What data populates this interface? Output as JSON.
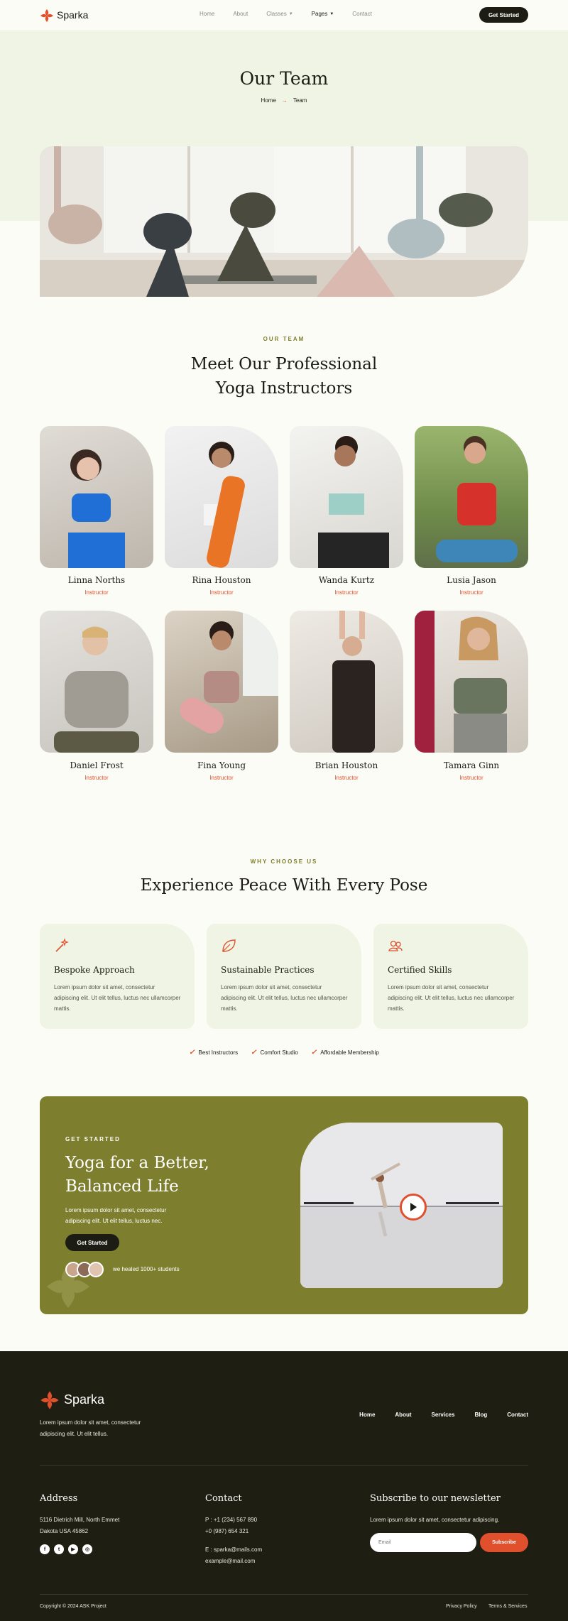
{
  "nav": {
    "brand": "Sparka",
    "links": [
      "Home",
      "About",
      "Classes",
      "Pages",
      "Contact"
    ],
    "cta": "Get Started"
  },
  "hero": {
    "title": "Our Team",
    "crumb_home": "Home",
    "crumb_current": "Team"
  },
  "team": {
    "eyebrow": "OUR TEAM",
    "title": "Meet Our Professional Yoga Instructors",
    "members": [
      {
        "name": "Linna Norths",
        "role": "Instructor"
      },
      {
        "name": "Rina Houston",
        "role": "Instructor"
      },
      {
        "name": "Wanda Kurtz",
        "role": "Instructor"
      },
      {
        "name": "Lusia Jason",
        "role": "Instructor"
      },
      {
        "name": "Daniel Frost",
        "role": "Instructor"
      },
      {
        "name": "Fina Young",
        "role": "Instructor"
      },
      {
        "name": "Brian Houston",
        "role": "Instructor"
      },
      {
        "name": "Tamara Ginn",
        "role": "Instructor"
      }
    ]
  },
  "why": {
    "eyebrow": "WHY CHOOSE US",
    "title": "Experience Peace With Every Pose",
    "cards": [
      {
        "title": "Bespoke Approach",
        "text": "Lorem ipsum dolor sit amet, consectetur adipiscing elit. Ut elit tellus, luctus nec ullamcorper mattis.",
        "icon": "magic-wand-icon"
      },
      {
        "title": "Sustainable Practices",
        "text": "Lorem ipsum dolor sit amet, consectetur adipiscing elit. Ut elit tellus, luctus nec ullamcorper mattis.",
        "icon": "leaf-icon"
      },
      {
        "title": "Certified Skills",
        "text": "Lorem ipsum dolor sit amet, consectetur adipiscing elit. Ut elit tellus, luctus nec ullamcorper mattis.",
        "icon": "users-icon"
      }
    ],
    "checks": [
      "Best Instructors",
      "Comfort Studio",
      "Affordable Membership"
    ]
  },
  "cta": {
    "eyebrow": "GET STARTED",
    "title_line1": "Yoga for a Better,",
    "title_line2": "Balanced Life",
    "text": "Lorem ipsum dolor sit amet, consectetur adipiscing elit. Ut elit tellus, luctus nec.",
    "button": "Get Started",
    "students": "we healed 1000+ students"
  },
  "footer": {
    "brand": "Sparka",
    "text": "Lorem ipsum dolor sit amet, consectetur adipiscing elit. Ut elit tellus.",
    "links": [
      "Home",
      "About",
      "Services",
      "Blog",
      "Contact"
    ],
    "address_title": "Address",
    "address_line1": "5116 Dietrich Mill, North Emmet",
    "address_line2": "Dakota USA 45862",
    "contact_title": "Contact",
    "phone1": "P : +1 (234) 567 890",
    "phone2": "+0 (987) 654 321",
    "email1": "E : sparka@mails.com",
    "email2": "example@mail.com",
    "newsletter_title": "Subscribe to our newsletter",
    "newsletter_text": "Lorem ipsum dolor sit amet, consectetur adipiscing.",
    "email_placeholder": "Email",
    "subscribe": "Subscribe",
    "copyright": "Copyright © 2024 ASK Project",
    "privacy": "Privacy Policy",
    "terms": "Terms & Services"
  },
  "colors": {
    "accent": "#e0502d",
    "olive": "#7e7f2e",
    "dark": "#1e1e12",
    "mint": "#eff4e4"
  }
}
